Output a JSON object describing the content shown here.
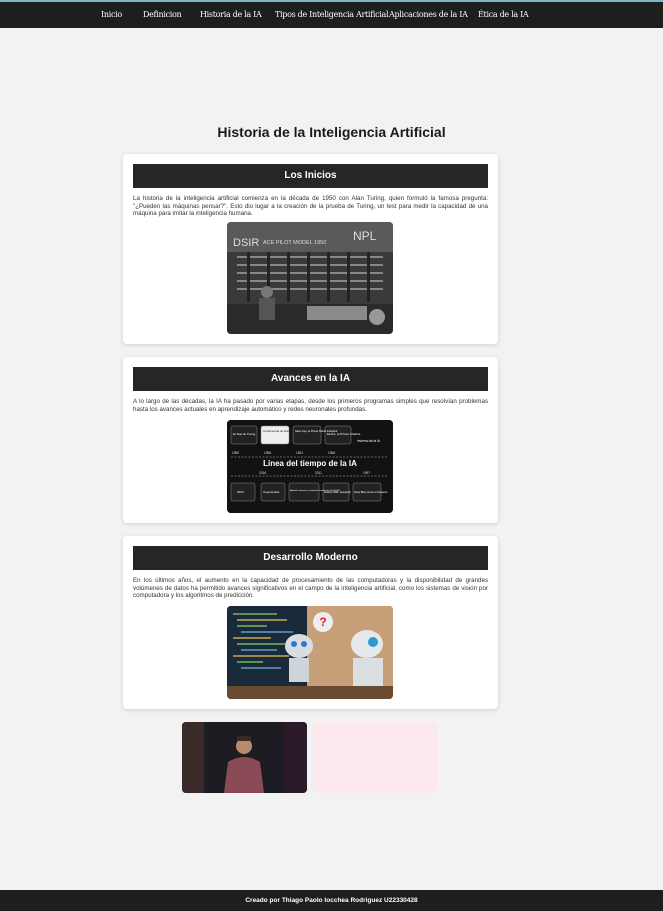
{
  "nav": {
    "items": [
      "Inicio",
      "Definicion",
      "Historia de la IA",
      "Tipos de Inteligencia Artificial",
      "Aplicaciones de la IA",
      "Ética de la IA"
    ]
  },
  "page": {
    "title": "Historia de la Inteligencia Artificial"
  },
  "sections": [
    {
      "heading": "Los Inicios",
      "text": "La historia de la inteligencia artificial comienza en la década de 1950 con Alan Turing, quien formuló la famosa pregunta: \"¿Pueden las máquinas pensar?\". Esto dio lugar a la creación de la prueba de Turing, un test para medir la capacidad de una máquina para imitar la inteligencia humana.",
      "image": {
        "panel_left": "DSIR",
        "panel_mid": "ACE PILOT MODEL 1950",
        "panel_right": "NPL"
      }
    },
    {
      "heading": "Avances en la IA",
      "text": "A lo largo de las décadas, la IA ha pasado por varias etapas, desde los primeros programas simples que resolvían problemas hasta los avances actuales en aprendizaje automático y redes neuronales profundas.",
      "image": {
        "title": "Linea del tiempo de la IA",
        "top_boxes": [
          "El Test de Turing",
          "Conferencia de Dartmouth",
          "Nace Lisp, el Primer Robot Industrial",
          "ELIZA, el Primer Chatbot"
        ],
        "top_years": [
          "1950",
          "1956",
          "1961",
          "1966"
        ],
        "side_label": "Invierno de la IA",
        "bottom_years": [
          "2016",
          "2011",
          "1997"
        ],
        "bottom_boxes": [
          "2023",
          "IA generativa",
          "AlphaGo derrota al campeón mundial de Go (2016)",
          "Watson IBM: Jeopardy!",
          "Deep Blue vence a Kasparov"
        ]
      }
    },
    {
      "heading": "Desarrollo Moderno",
      "text": "En los últimos años, el aumento en la capacidad de procesamiento de las computadoras y la disponibilidad de grandes volúmenes de datos ha permitido avances significativos en el campo de la inteligencia artificial, como los sistemas de visión por computadora y los algoritmos de predicción.",
      "image": {
        "sign": "?"
      }
    }
  ],
  "footer": {
    "text": "Creado por Thiago Paolo Iocchea Rodriguez U22330428"
  },
  "colors": {
    "bar": "#1e1e1e",
    "accent": "#7fb3c9",
    "heading_bg": "#262626"
  }
}
